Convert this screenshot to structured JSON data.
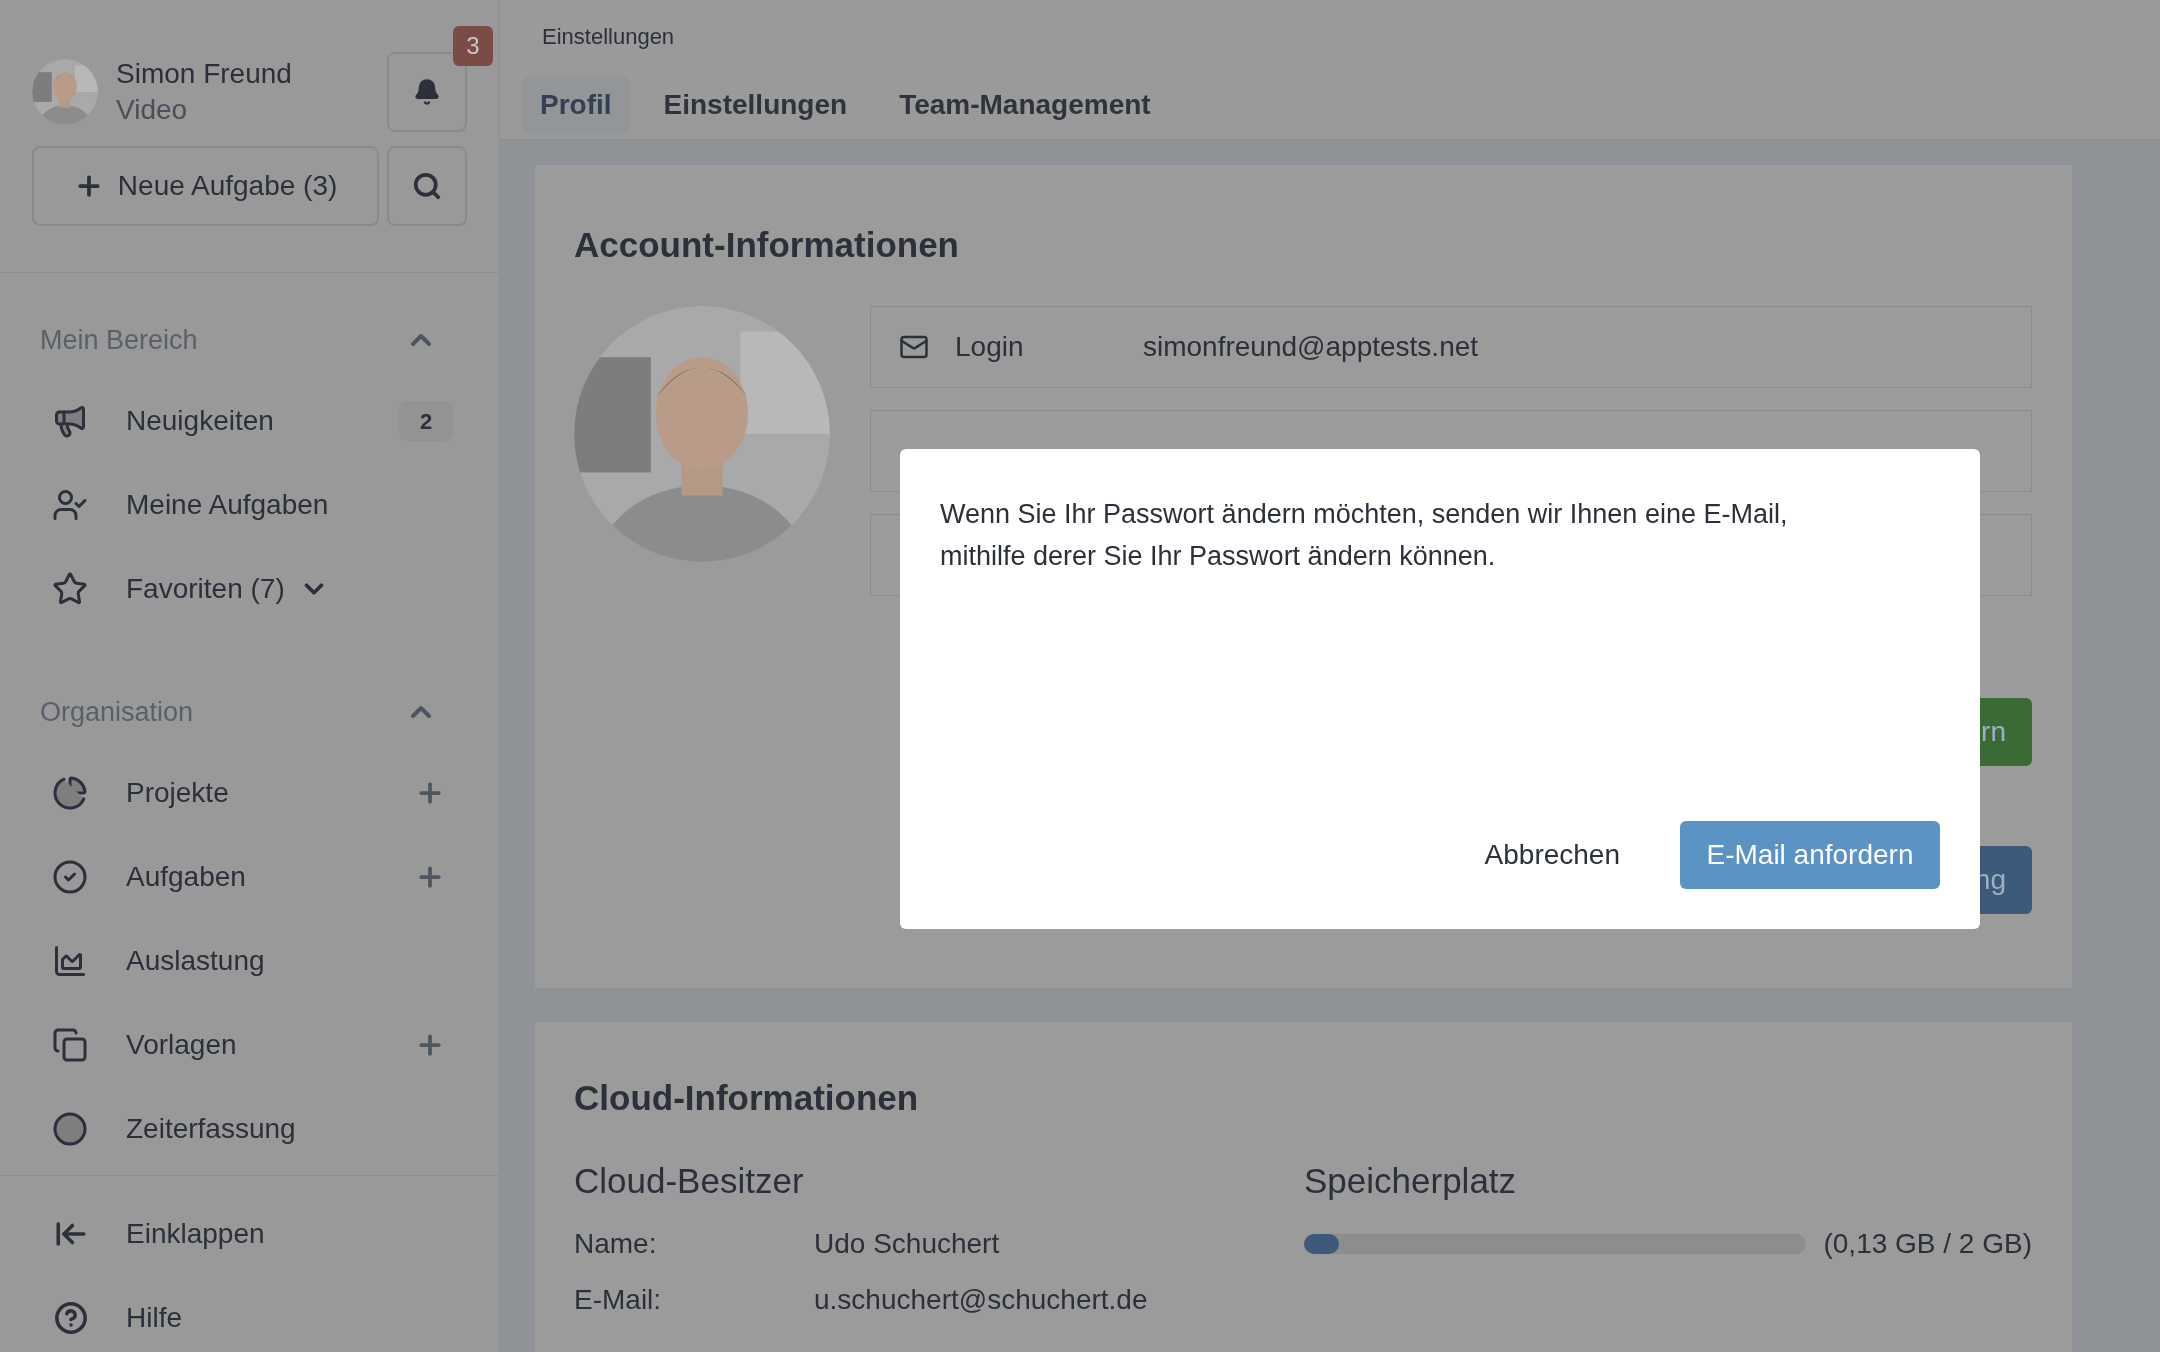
{
  "user": {
    "name": "Simon Freund",
    "role": "Video",
    "notifications": "3"
  },
  "new_task_button": "Neue Aufgabe (3)",
  "sidebar": {
    "sections": [
      {
        "title": "Mein Bereich",
        "expanded": true,
        "items": [
          {
            "label": "Neuigkeiten",
            "badge": "2"
          },
          {
            "label": "Meine Aufgaben"
          },
          {
            "label": "Favoriten (7)",
            "expanded": false
          }
        ]
      },
      {
        "title": "Organisation",
        "expanded": true,
        "items": [
          {
            "label": "Projekte",
            "add": true
          },
          {
            "label": "Aufgaben",
            "add": true
          },
          {
            "label": "Auslastung"
          },
          {
            "label": "Vorlagen",
            "add": true
          },
          {
            "label": "Zeiterfassung"
          }
        ]
      }
    ],
    "footer": [
      {
        "label": "Einklappen"
      },
      {
        "label": "Hilfe"
      }
    ]
  },
  "breadcrumb": "Einstellungen",
  "tabs": [
    {
      "label": "Profil",
      "selected": true
    },
    {
      "label": "Einstellungen",
      "selected": false
    },
    {
      "label": "Team-Management",
      "selected": false
    }
  ],
  "account": {
    "title": "Account-Informationen",
    "fields": [
      {
        "label": "Login",
        "value": "simonfreund@apptests.net"
      }
    ],
    "buttons": [
      {
        "label": "rn",
        "kind": "success"
      },
      {
        "label": "ng",
        "kind": "primary"
      }
    ]
  },
  "cloud": {
    "title": "Cloud-Informationen",
    "owner_heading": "Cloud-Besitzer",
    "owner": [
      {
        "label": "Name:",
        "value": "Udo Schuchert"
      },
      {
        "label": "E-Mail:",
        "value": "u.schuchert@schuchert.de"
      }
    ],
    "storage_heading": "Speicherplatz",
    "storage": {
      "level": 0.07,
      "reading": "(0,13 GB / 2 GB)"
    }
  },
  "modal": {
    "text": "Wenn Sie Ihr Passwort ändern möchten, senden wir Ihnen eine E-Mail, mithilfe derer Sie Ihr Passwort ändern können.",
    "cancel": "Abbrechen",
    "confirm": "E-Mail anfordern"
  }
}
